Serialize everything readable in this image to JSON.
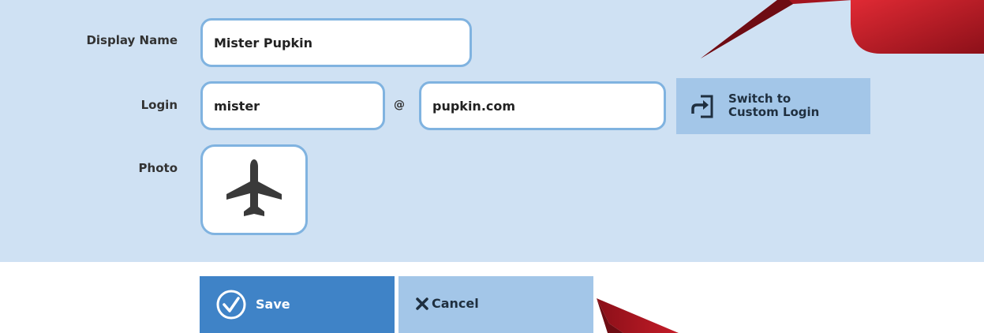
{
  "form": {
    "display_name": {
      "label": "Display Name",
      "value": "Mister Pupkin"
    },
    "login": {
      "label": "Login",
      "user_value": "mister",
      "at_symbol": "@",
      "domain_value": "pupkin.com"
    },
    "switch_button": {
      "line1": "Switch to",
      "line2": "Custom Login",
      "icon": "sign-in-arrow-icon"
    },
    "photo": {
      "label": "Photo",
      "icon": "airplane-icon"
    }
  },
  "actions": {
    "save_label": "Save",
    "save_icon": "check-circle-icon",
    "cancel_label": "Cancel",
    "cancel_icon": "x-icon"
  },
  "colors": {
    "panel_background": "#cfe1f3",
    "primary_button": "#3f83c7",
    "secondary_button": "#a3c6e8",
    "input_border": "#80b3e0",
    "decor_red": "#b51a27"
  }
}
